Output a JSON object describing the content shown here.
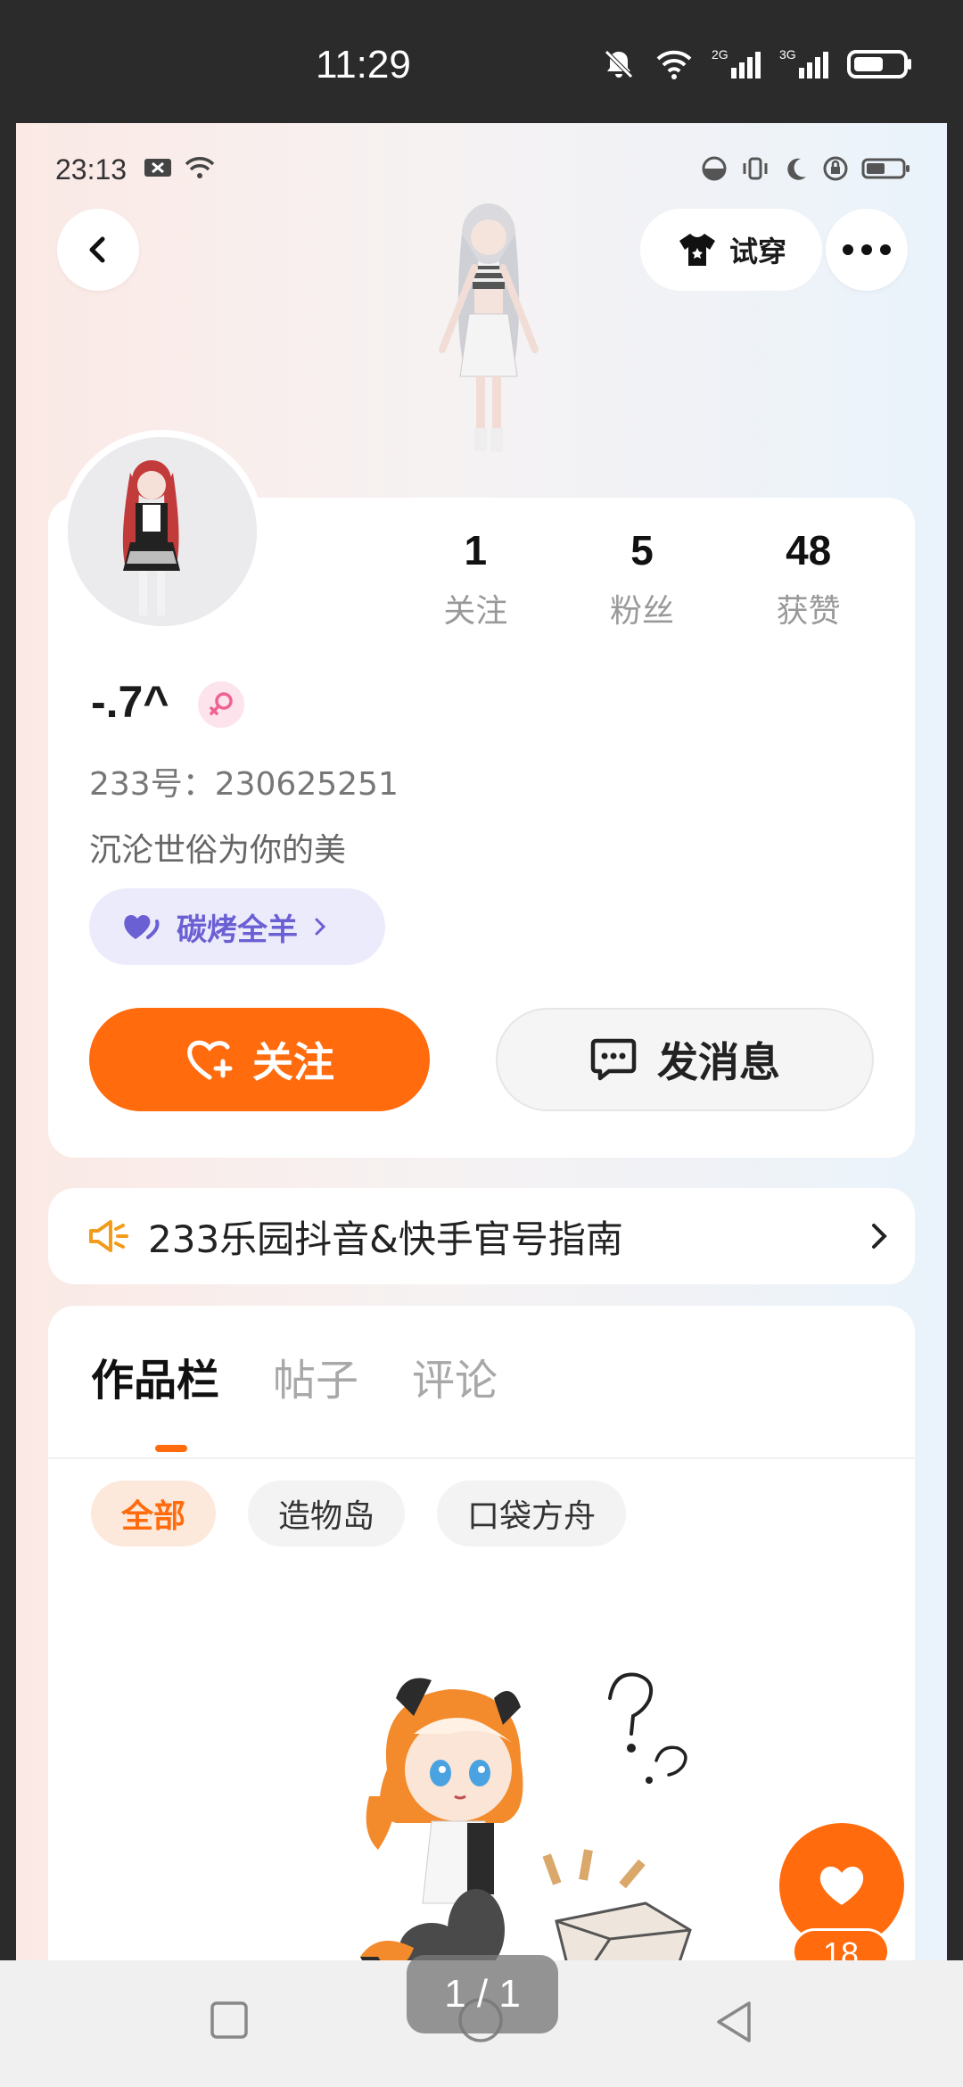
{
  "outer_status": {
    "time": "11:29",
    "signal_labels": [
      "2G",
      "3G"
    ]
  },
  "inner_status": {
    "time": "23:13"
  },
  "top_nav": {
    "try_on_label": "试穿"
  },
  "profile": {
    "stats": [
      {
        "value": "1",
        "label": "关注"
      },
      {
        "value": "5",
        "label": "粉丝"
      },
      {
        "value": "48",
        "label": "获赞"
      }
    ],
    "username": "-.7^",
    "uid": "233号：230625251",
    "bio": "沉沦世俗为你的美",
    "tag": "碳烤全羊",
    "follow_label": "关注",
    "message_label": "发消息"
  },
  "notice": {
    "text": "233乐园抖音&快手官号指南"
  },
  "works": {
    "tabs": [
      "作品栏",
      "帖子",
      "评论"
    ],
    "filters": [
      "全部",
      "造物岛",
      "口袋方舟"
    ]
  },
  "like": {
    "count": "18"
  },
  "viewer": {
    "page_indicator": "1 / 1"
  },
  "colors": {
    "accent": "#ff6b0d",
    "tag_purple": "#6b5fd4"
  }
}
